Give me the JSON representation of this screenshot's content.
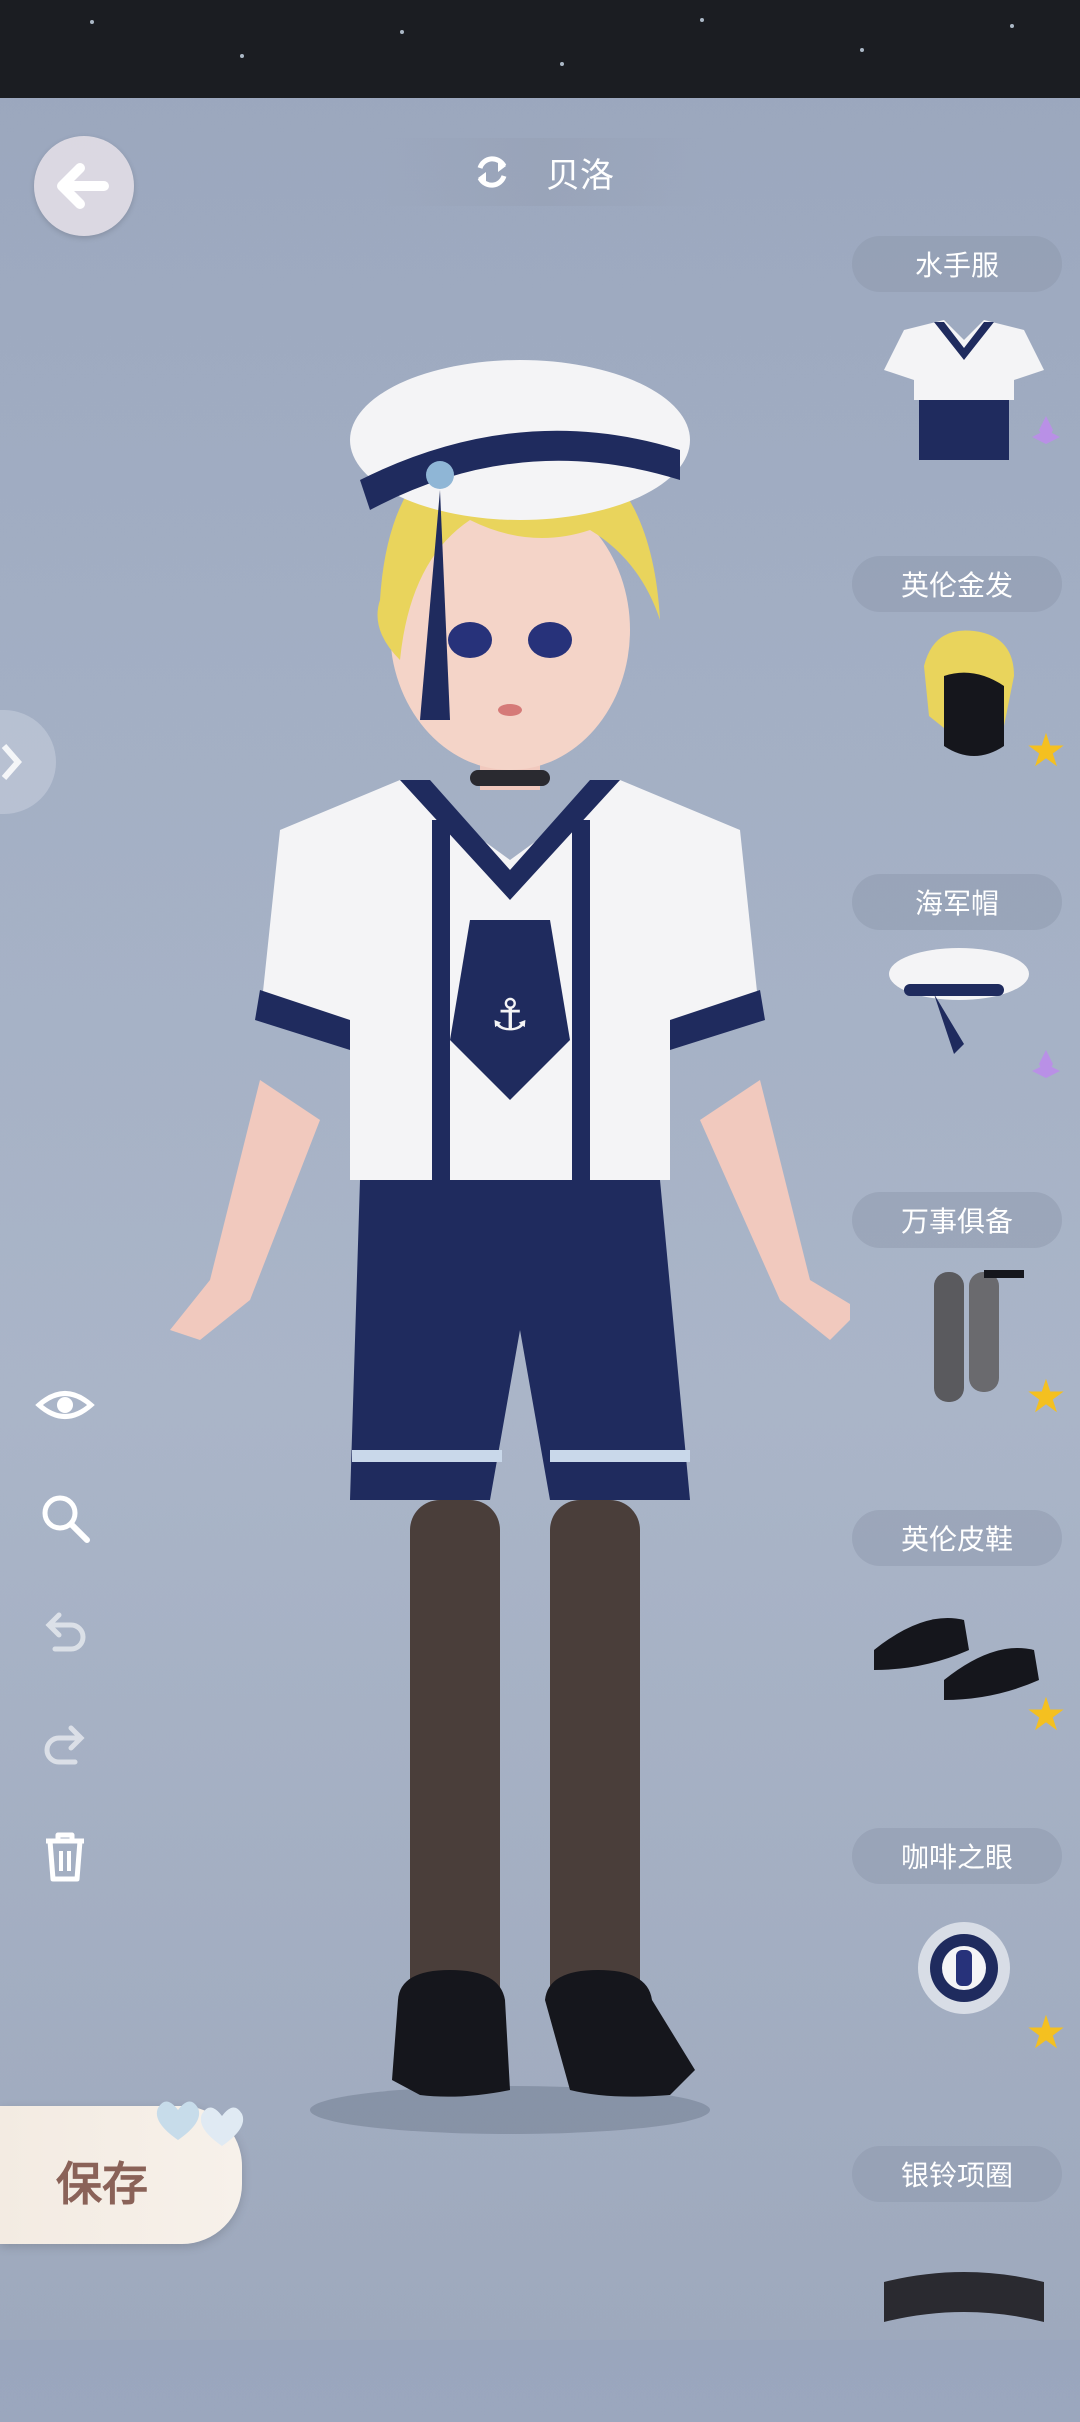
{
  "header": {
    "title": "贝洛"
  },
  "toolbar": {
    "save_label": "保存"
  },
  "icons": {
    "back": "back-arrow-icon",
    "swap": "swap-icon",
    "eye": "eye-icon",
    "zoom": "zoom-icon",
    "undo": "undo-icon",
    "redo": "redo-icon",
    "trash": "trash-icon"
  },
  "items": [
    {
      "label": "水手服",
      "rarity": "purple"
    },
    {
      "label": "英伦金发",
      "rarity": "gold"
    },
    {
      "label": "海军帽",
      "rarity": "purple"
    },
    {
      "label": "万事俱备",
      "rarity": "gold"
    },
    {
      "label": "英伦皮鞋",
      "rarity": "gold"
    },
    {
      "label": "咖啡之眼",
      "rarity": "gold"
    },
    {
      "label": "银铃项圈",
      "rarity": ""
    }
  ],
  "colors": {
    "navy": "#1f2b5e",
    "gold": "#f4c020",
    "purple": "#b990e6",
    "bg": "#a3afc4"
  }
}
